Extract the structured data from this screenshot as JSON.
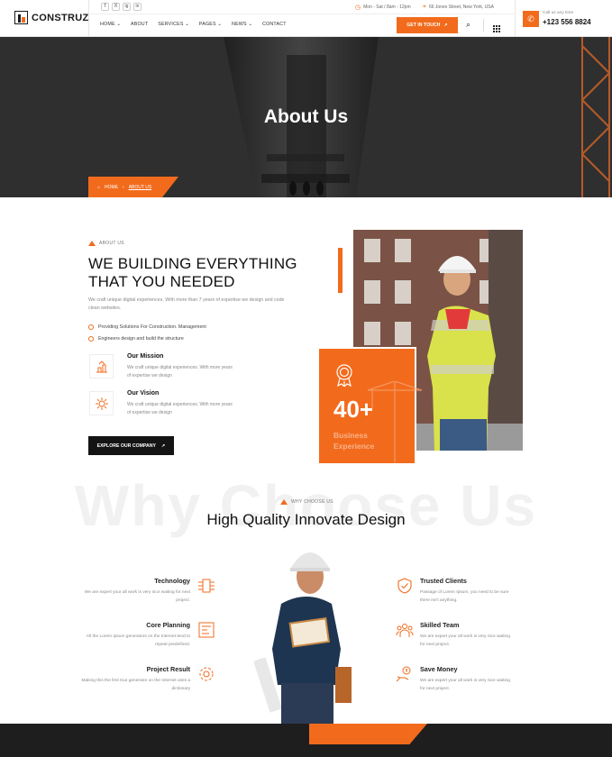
{
  "brand": {
    "name": "CONSTRUZ",
    "accent": "#f26b1d",
    "dark": "#141414"
  },
  "topbar": {
    "socials": [
      "f",
      "X",
      "ig",
      "in"
    ],
    "hours": "Mon - Sat / 8am - 12pm",
    "address": "66 Jones Street, New York, USA"
  },
  "nav": {
    "items": [
      "HOME ⌄",
      "ABOUT",
      "SERVICES ⌄",
      "PAGES ⌄",
      "NEWS ⌄",
      "CONTACT"
    ],
    "cta": "GET IN TOUCH",
    "call_label": "Call us any time",
    "phone": "+123 556 8824"
  },
  "hero": {
    "title": "About Us",
    "crumb_home": "HOME",
    "crumb_current": "ABOUT US"
  },
  "about": {
    "label": "ABOUT US",
    "title_line1": "WE BUILDING EVERYTHING",
    "title_line2": "THAT YOU NEEDED",
    "desc": "We craft unique digital experiences. With more than 7 years of expertise we design and code clean websites.",
    "points": [
      "Providing Solutions For Construction. Management",
      "Engineers design and build the structure"
    ],
    "features": [
      {
        "title": "Our Mission",
        "desc": "We craft unique digital experiences. With more years of expertise we design"
      },
      {
        "title": "Our Vision",
        "desc": "We craft unique digital experiences. With more years of expertise we design"
      }
    ],
    "button": "EXPLORE OUR COMPANY",
    "stat_number": "40+",
    "stat_label_1": "Business",
    "stat_label_2": "Experience"
  },
  "why": {
    "watermark": "Why Choose Us",
    "label": "WHY CHOOSE US",
    "title": "High Quality Innovate Design",
    "left": [
      {
        "title": "Technology",
        "desc": "We are expert your all work is very nice waiting for next project."
      },
      {
        "title": "Core Planning",
        "desc": "All the Lorem Ipsum generators on the Internet tend to repeat predefined."
      },
      {
        "title": "Project Result",
        "desc": "Making this the first true generator on the Internet uses a dictionary"
      }
    ],
    "right": [
      {
        "title": "Trusted Clients",
        "desc": "Passage of Lorem Ipsum, you need to be sure there isn't anything."
      },
      {
        "title": "Skilled Team",
        "desc": "We are expert your all work is very nice waiting for next project."
      },
      {
        "title": "Save Money",
        "desc": "We are expert your all work is very nice waiting for next project."
      }
    ]
  }
}
